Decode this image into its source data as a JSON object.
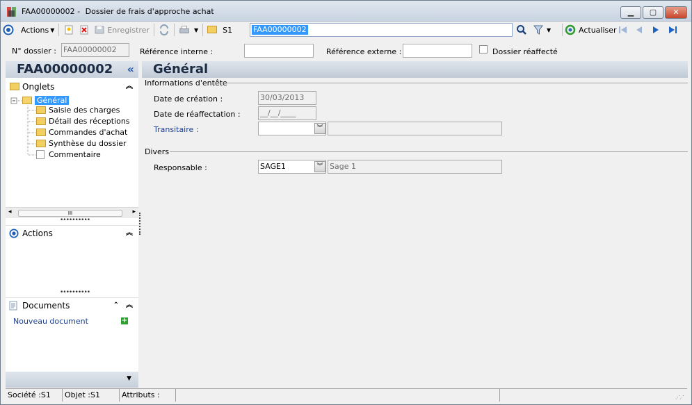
{
  "window": {
    "title_code": "FAA00000002 -",
    "title_text": "Dossier de frais d'approche achat",
    "minimize": "▁",
    "maximize": "▢",
    "close": "✕"
  },
  "toolbar": {
    "actions_label": "Actions",
    "save_label": "Enregistrer",
    "folder_label": "S1",
    "search_value": "FAA00000002",
    "refresh_label": "Actualiser"
  },
  "header": {
    "dossier_label": "N° dossier :",
    "dossier_value": "FAA00000002",
    "ref_interne_label": "Référence interne :",
    "ref_interne_value": "",
    "ref_externe_label": "Référence externe :",
    "ref_externe_value": "",
    "reaffecte_label": "Dossier réaffecté"
  },
  "left": {
    "panel_title": "FAA00000002",
    "collapse": "«",
    "onglets_title": "Onglets",
    "tree": [
      {
        "label": "Général",
        "selected": true
      },
      {
        "label": "Saisie des charges"
      },
      {
        "label": "Détail des réceptions"
      },
      {
        "label": "Commandes d'achat"
      },
      {
        "label": "Synthèse du dossier"
      },
      {
        "label": "Commentaire"
      }
    ],
    "scroll_thumb": "III",
    "actions_title": "Actions",
    "documents_title": "Documents",
    "new_document": "Nouveau document",
    "chev_up": "⌃",
    "chev_double": "︽"
  },
  "main": {
    "title": "Général",
    "group_entete": "Informations d'entête",
    "date_creation_label": "Date de création :",
    "date_creation_value": "30/03/2013",
    "date_reaffectation_label": "Date de réaffectation :",
    "date_reaffectation_value": "__/__/____",
    "transitaire_label": "Transitaire :",
    "transitaire_value": "",
    "group_divers": "Divers",
    "responsable_label": "Responsable :",
    "responsable_value": "SAGE1",
    "responsable_name": "Sage 1"
  },
  "status": {
    "societe": "Société :S1",
    "objet": "Objet :S1",
    "attributs": "Attributs :"
  }
}
